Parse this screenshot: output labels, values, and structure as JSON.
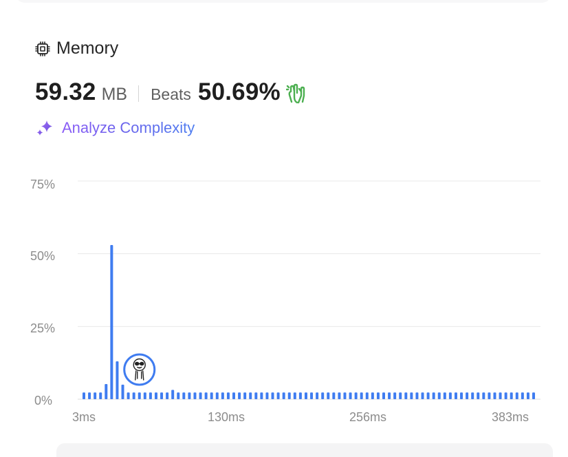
{
  "memory": {
    "title": "Memory",
    "value": "59.32",
    "unit": "MB",
    "beats_label": "Beats",
    "beats_value": "50.69%"
  },
  "analyze": {
    "label": "Analyze Complexity"
  },
  "icons": {
    "title": "chip-icon",
    "beats": "clapping-hands-icon",
    "analyze": "sparkle-icon",
    "marker": "avatar-marker"
  },
  "colors": {
    "bar": "#3f7cf0",
    "accent_purple": "#8b5cf6",
    "clap_green": "#4caf50",
    "grid": "#e8e8e8",
    "axis_text": "#8c8c8c"
  },
  "chart_data": {
    "type": "bar",
    "ylabel": "",
    "xlabel": "",
    "y_ticks": [
      "75%",
      "50%",
      "25%",
      "0%"
    ],
    "x_ticks": [
      "3ms",
      "130ms",
      "256ms",
      "383ms"
    ],
    "ylim": [
      0,
      75
    ],
    "grid": true,
    "values": [
      2.3,
      2.3,
      2.3,
      2.3,
      5.2,
      53,
      13,
      5,
      2.3,
      2.3,
      2.3,
      2.3,
      2.3,
      2.3,
      2.3,
      2.3,
      3.2,
      2.3,
      2.3,
      2.3,
      2.3,
      2.3,
      2.3,
      2.3,
      2.3,
      2.3,
      2.3,
      2.3,
      2.3,
      2.3,
      2.3,
      2.3,
      2.3,
      2.3,
      2.3,
      2.3,
      2.3,
      2.3,
      2.3,
      2.3,
      2.3,
      2.3,
      2.3,
      2.3,
      2.3,
      2.3,
      2.3,
      2.3,
      2.3,
      2.3,
      2.3,
      2.3,
      2.3,
      2.3,
      2.3,
      2.3,
      2.3,
      2.3,
      2.3,
      2.3,
      2.3,
      2.3,
      2.3,
      2.3,
      2.3,
      2.3,
      2.3,
      2.3,
      2.3,
      2.3,
      2.3,
      2.3,
      2.3,
      2.3,
      2.3,
      2.3,
      2.3,
      2.3,
      2.3,
      2.3,
      2.3,
      2.3
    ],
    "marker_index": 10
  }
}
